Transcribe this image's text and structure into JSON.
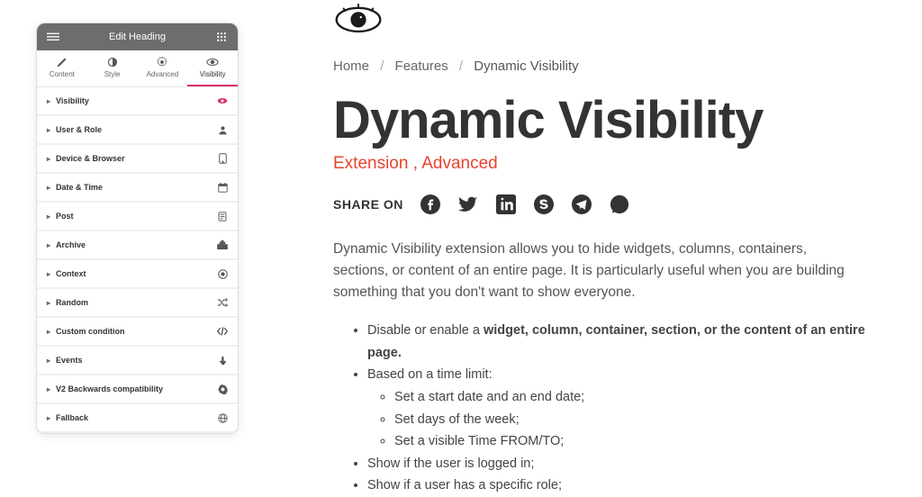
{
  "phone": {
    "header_title": "Edit Heading",
    "tabs": [
      {
        "label": "Content"
      },
      {
        "label": "Style"
      },
      {
        "label": "Advanced"
      },
      {
        "label": "Visibility"
      }
    ],
    "accordion": [
      {
        "label": "Visibility",
        "icon": "eye-red"
      },
      {
        "label": "User & Role",
        "icon": "user"
      },
      {
        "label": "Device & Browser",
        "icon": "device"
      },
      {
        "label": "Date & Time",
        "icon": "calendar"
      },
      {
        "label": "Post",
        "icon": "post"
      },
      {
        "label": "Archive",
        "icon": "archive"
      },
      {
        "label": "Context",
        "icon": "context"
      },
      {
        "label": "Random",
        "icon": "shuffle"
      },
      {
        "label": "Custom condition",
        "icon": "code"
      },
      {
        "label": "Events",
        "icon": "pointer"
      },
      {
        "label": "V2 Backwards compatibility",
        "icon": "gear"
      },
      {
        "label": "Fallback",
        "icon": "globe"
      }
    ]
  },
  "breadcrumb": {
    "home": "Home",
    "features": "Features",
    "current": "Dynamic Visibility"
  },
  "title": "Dynamic Visibility",
  "subtitle": "Extension , Advanced",
  "share_label": "SHARE ON",
  "description": "Dynamic Visibility extension allows you to hide widgets, columns, containers, sections, or content of an entire page. It is particularly useful when you are building something that you don't want to show everyone.",
  "features": {
    "f1_pre": "Disable or enable a ",
    "f1_bold": "widget, column, container, section, or the content of an entire page.",
    "f2": "Based on a time limit:",
    "f2_1": "Set a start date and an end date;",
    "f2_2": "Set days of the week;",
    "f2_3": "Set a visible Time FROM/TO;",
    "f3": "Show if the user is logged in;",
    "f4": "Show if a user has a specific role;"
  }
}
